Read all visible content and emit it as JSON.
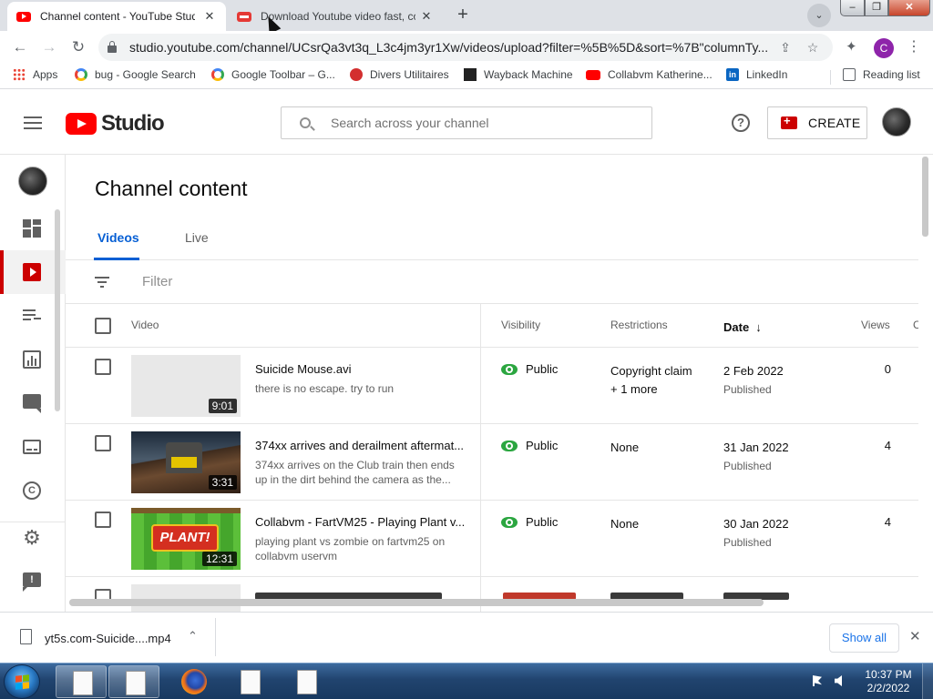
{
  "browser": {
    "tabs": [
      {
        "title": "Channel content - YouTube Studio",
        "active": true
      },
      {
        "title": "Download Youtube video fast, co",
        "active": false
      }
    ],
    "url": "studio.youtube.com/channel/UCsrQa3vt3q_L3c4jm3yr1Xw/videos/upload?filter=%5B%5D&sort=%7B\"columnTy..."
  },
  "bookmarks": [
    {
      "label": "Apps",
      "icon": "apps-grid-icon"
    },
    {
      "label": "bug - Google Search",
      "icon": "google-icon"
    },
    {
      "label": "Google Toolbar – G...",
      "icon": "google-icon"
    },
    {
      "label": "Divers Utilitaires",
      "icon": "divers-icon"
    },
    {
      "label": "Wayback Machine",
      "icon": "wayback-icon"
    },
    {
      "label": "Collabvm Katherine...",
      "icon": "youtube-icon"
    },
    {
      "label": "LinkedIn",
      "icon": "linkedin-icon"
    },
    {
      "label": "Reading list",
      "icon": "reading-list-icon"
    }
  ],
  "studio": {
    "logo_text": "Studio",
    "search_placeholder": "Search across your channel",
    "create_label": "CREATE",
    "page_title": "Channel content",
    "tabs": [
      "Videos",
      "Live"
    ],
    "filter_label": "Filter",
    "columns": {
      "video": "Video",
      "visibility": "Visibility",
      "restrictions": "Restrictions",
      "date": "Date",
      "views": "Views",
      "comments": "C"
    },
    "rows": [
      {
        "title": "Suicide Mouse.avi",
        "description": "there is no escape. try to run",
        "duration": "9:01",
        "visibility": "Public",
        "restriction": "Copyright claim",
        "restriction_more": "+ 1 more",
        "date": "2 Feb 2022",
        "status": "Published",
        "views": "0"
      },
      {
        "title": "374xx arrives and derailment aftermat...",
        "description": "374xx arrives on the Club train then ends up in the dirt behind the camera as the...",
        "duration": "3:31",
        "visibility": "Public",
        "restriction": "None",
        "restriction_more": "",
        "date": "31 Jan 2022",
        "status": "Published",
        "views": "4"
      },
      {
        "title": "Collabvm - FartVM25 - Playing Plant v...",
        "description": "playing plant vs zombie on fartvm25 on collabvm uservm",
        "duration": "12:31",
        "thumb_text": "PLANT!",
        "visibility": "Public",
        "restriction": "None",
        "restriction_more": "",
        "date": "30 Jan 2022",
        "status": "Published",
        "views": "4"
      }
    ]
  },
  "download_bar": {
    "filename": "yt5s.com-Suicide....mp4",
    "show_all": "Show all"
  },
  "taskbar": {
    "time": "10:37 PM",
    "date": "2/2/2022"
  },
  "colors": {
    "youtube_red": "#ff0000",
    "accent_blue": "#065fd4",
    "public_green": "#2ba640"
  }
}
